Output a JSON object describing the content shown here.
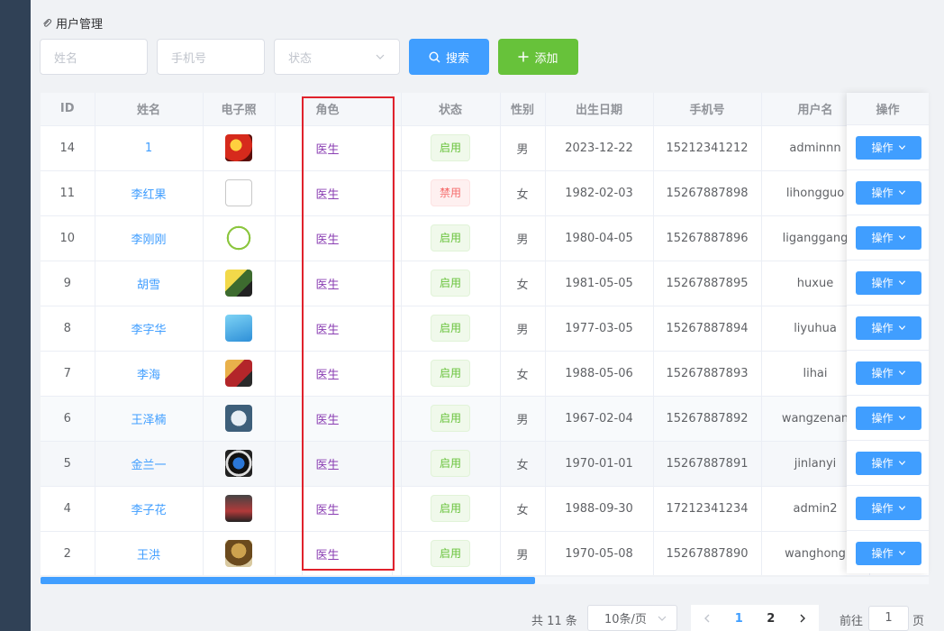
{
  "breadcrumb": {
    "label": "用户管理"
  },
  "filters": {
    "name_placeholder": "姓名",
    "phone_placeholder": "手机号",
    "status_placeholder": "状态",
    "search_label": "搜索",
    "add_label": "添加"
  },
  "table": {
    "headers": [
      "ID",
      "姓名",
      "电子照",
      "",
      "角色",
      "",
      "状态",
      "性别",
      "出生日期",
      "手机号",
      "用户名"
    ],
    "op_header": "操作",
    "rows": [
      {
        "id": "14",
        "name": "1",
        "role": "医生",
        "status": "启用",
        "status_type": "on",
        "gender": "男",
        "birth": "2023-12-22",
        "phone": "15212341212",
        "username": "adminnn",
        "op": "操作"
      },
      {
        "id": "11",
        "name": "李红果",
        "role": "医生",
        "status": "禁用",
        "status_type": "off",
        "gender": "女",
        "birth": "1982-02-03",
        "phone": "15267887898",
        "username": "lihongguo",
        "op": "操作"
      },
      {
        "id": "10",
        "name": "李刚刚",
        "role": "医生",
        "status": "启用",
        "status_type": "on",
        "gender": "男",
        "birth": "1980-04-05",
        "phone": "15267887896",
        "username": "liganggang",
        "op": "操作"
      },
      {
        "id": "9",
        "name": "胡雪",
        "role": "医生",
        "status": "启用",
        "status_type": "on",
        "gender": "女",
        "birth": "1981-05-05",
        "phone": "15267887895",
        "username": "huxue",
        "op": "操作"
      },
      {
        "id": "8",
        "name": "李字华",
        "role": "医生",
        "status": "启用",
        "status_type": "on",
        "gender": "男",
        "birth": "1977-03-05",
        "phone": "15267887894",
        "username": "liyuhua",
        "op": "操作"
      },
      {
        "id": "7",
        "name": "李海",
        "role": "医生",
        "status": "启用",
        "status_type": "on",
        "gender": "女",
        "birth": "1988-05-06",
        "phone": "15267887893",
        "username": "lihai",
        "op": "操作"
      },
      {
        "id": "6",
        "name": "王泽楠",
        "role": "医生",
        "status": "启用",
        "status_type": "on",
        "gender": "男",
        "birth": "1967-02-04",
        "phone": "15267887892",
        "username": "wangzenan",
        "op": "操作"
      },
      {
        "id": "5",
        "name": "金兰一",
        "role": "医生",
        "status": "启用",
        "status_type": "on",
        "gender": "女",
        "birth": "1970-01-01",
        "phone": "15267887891",
        "username": "jinlanyi",
        "op": "操作"
      },
      {
        "id": "4",
        "name": "李子花",
        "role": "医生",
        "status": "启用",
        "status_type": "on",
        "gender": "女",
        "birth": "1988-09-30",
        "phone": "17212341234",
        "username": "admin2",
        "op": "操作"
      },
      {
        "id": "2",
        "name": "王洪",
        "role": "医生",
        "status": "启用",
        "status_type": "on",
        "gender": "男",
        "birth": "1970-05-08",
        "phone": "15267887890",
        "username": "wanghong",
        "op": "操作"
      }
    ]
  },
  "pagination": {
    "total_text": "共 11 条",
    "page_size": "10条/页",
    "pages": [
      "1",
      "2"
    ],
    "current_page": "1",
    "goto_label": "前往",
    "goto_value": "1",
    "goto_suffix": "页"
  },
  "colors": {
    "primary": "#409eff",
    "success": "#67c23a",
    "danger": "#f56c6c",
    "role_text": "#8b3fb3",
    "highlight_box": "#e0222c",
    "sidebar": "#304156"
  }
}
